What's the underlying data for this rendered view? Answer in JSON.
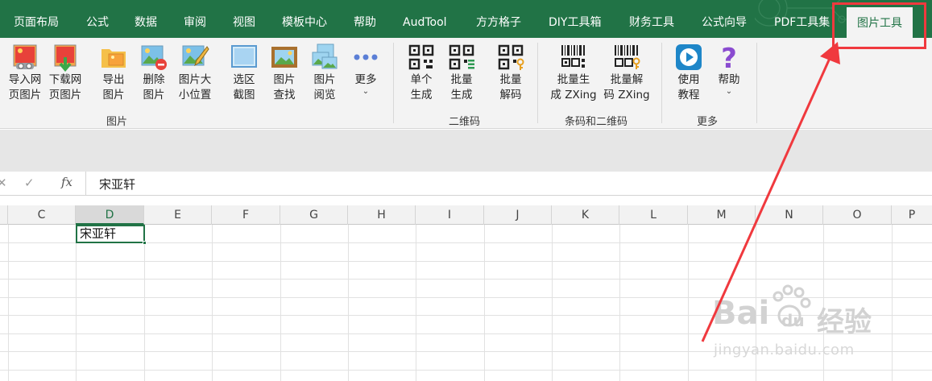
{
  "tabs": [
    {
      "label": "页面布局"
    },
    {
      "label": "公式"
    },
    {
      "label": "数据"
    },
    {
      "label": "审阅"
    },
    {
      "label": "视图"
    },
    {
      "label": "模板中心"
    },
    {
      "label": "帮助"
    },
    {
      "label": "AudTool"
    },
    {
      "label": "方方格子"
    },
    {
      "label": "DIY工具箱"
    },
    {
      "label": "财务工具"
    },
    {
      "label": "公式向导"
    },
    {
      "label": "PDF工具集"
    },
    {
      "label": "图片工具"
    }
  ],
  "ribbon": {
    "groups": {
      "picture": "图片",
      "qrcode": "二维码",
      "barcode": "条码和二维码",
      "more": "更多"
    },
    "buttons": {
      "import_web_1": "导入网",
      "import_web_2": "页图片",
      "download_web_1": "下载网",
      "download_web_2": "页图片",
      "export_1": "导出",
      "export_2": "图片",
      "delete_1": "删除",
      "delete_2": "图片",
      "size_1": "图片大",
      "size_2": "小位置",
      "select_shot_1": "选区",
      "select_shot_2": "截图",
      "find_1": "图片",
      "find_2": "查找",
      "browse_1": "图片",
      "browse_2": "阅览",
      "more_1": "更多",
      "single_1": "单个",
      "single_2": "生成",
      "batch_1": "批量",
      "batch_2": "生成",
      "batch_decode_1": "批量",
      "batch_decode_2": "解码",
      "zx_gen_1": "批量生",
      "zx_gen_2": "成 ZXing",
      "zx_dec_1": "批量解",
      "zx_dec_2": "码 ZXing",
      "tutorial_1": "使用",
      "tutorial_2": "教程",
      "help_1": "帮助"
    }
  },
  "formula_bar": {
    "fx_label": "fx",
    "content": "宋亚轩"
  },
  "sheet": {
    "columns": [
      "C",
      "D",
      "E",
      "F",
      "G",
      "H",
      "I",
      "J",
      "K",
      "L",
      "M",
      "N",
      "O",
      "P"
    ],
    "active_column": "D",
    "active_cell_value": "宋亚轩"
  },
  "watermark": {
    "brand": "Bai",
    "brand_2": "du",
    "suffix": "经验",
    "url": "jingyan.baidu.com"
  },
  "colors": {
    "accent": "#217346",
    "highlight": "#f0393e"
  }
}
